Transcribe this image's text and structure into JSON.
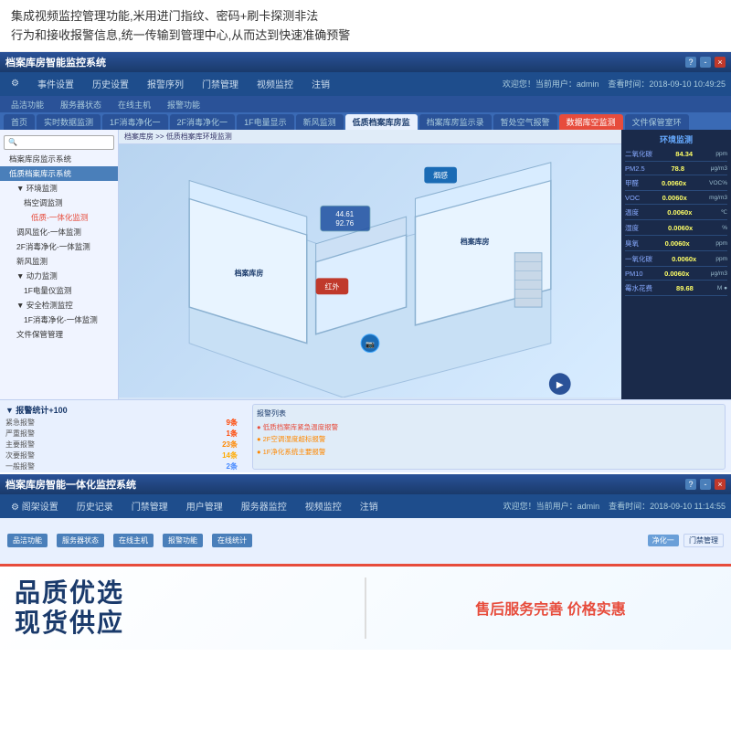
{
  "top_text": {
    "line1": "集成视频监控管理功能,米用进门指纹、密码+刷卡探测非法",
    "line2": "行为和接收报警信息,统一传输到管理中心,从而达到快速准确预警"
  },
  "monitoring_system_1": {
    "title": "档案库房智能监控系统",
    "controls": [
      "?",
      "-",
      "□",
      "×"
    ],
    "navbar": {
      "items": [
        "阁架设置",
        "事件设置",
        "历史设置",
        "报警序列",
        "门禁管理",
        "视频监控",
        "注销"
      ],
      "info": "欢迎您！当前用户：admin",
      "time": "查看时间：2018-09-10 10:49:25"
    },
    "tabs": [
      {
        "label": "品洁功能",
        "active": false
      },
      {
        "label": "服务器状态",
        "active": false
      },
      {
        "label": "在线主机",
        "active": false
      },
      {
        "label": "报警功能",
        "active": false
      }
    ],
    "content_tabs": [
      {
        "label": "首页",
        "active": false
      },
      {
        "label": "实时数据监测",
        "active": false
      },
      {
        "label": "1F消毒净化一",
        "active": false
      },
      {
        "label": "2F消毒净化一",
        "active": false
      },
      {
        "label": "1F电量显示",
        "active": false
      },
      {
        "label": "新风监测",
        "active": false
      },
      {
        "label": "低质档案库房监",
        "active": true,
        "highlight": false
      },
      {
        "label": "档案库房监示录",
        "active": false
      },
      {
        "label": "暂处空气报警",
        "active": false
      },
      {
        "label": "数据库空监测",
        "active": false,
        "highlight": true
      },
      {
        "label": "文件保管室环",
        "active": false
      }
    ],
    "breadcrumb": "档案库房 >> 低质档案库环境监测",
    "sidebar": {
      "tree": [
        {
          "label": "档案库房监示系统",
          "level": 0
        },
        {
          "label": "低质档案库示系统",
          "level": 1,
          "selected": true
        },
        {
          "label": "环境监测",
          "level": 2
        },
        {
          "label": "档空调监测",
          "level": 3
        },
        {
          "label": "低质-一体化监测",
          "level": 3,
          "red": true
        },
        {
          "label": "调风监化-一体监测",
          "level": 2
        },
        {
          "label": "2F消毒净化-一体监测",
          "level": 2
        },
        {
          "label": "新风监测",
          "level": 2
        },
        {
          "label": "动力监测",
          "level": 2
        },
        {
          "label": "1F电量仪监测",
          "level": 3
        },
        {
          "label": "安全检测监控",
          "level": 2
        },
        {
          "label": "1F消毒净化-一体监测",
          "level": 3
        },
        {
          "label": "文件保管管理",
          "level": 2
        }
      ]
    },
    "floor_sensors": [
      {
        "label": "烟感",
        "x": "62%",
        "y": "12%"
      },
      {
        "label": "红外",
        "x": "33%",
        "y": "52%"
      },
      {
        "label": "44.61\n92.76",
        "x": "40%",
        "y": "26%",
        "type": "value"
      }
    ],
    "environment": {
      "title": "环境监测",
      "rows": [
        {
          "label": "二氧化碳",
          "value": "84.34",
          "unit": "ppm"
        },
        {
          "label": "PM2.5",
          "value": "78.8",
          "unit": "μg/m3"
        },
        {
          "label": "甲醛",
          "value": "0.0060x",
          "unit": "VOC%"
        },
        {
          "label": "VOC",
          "value": "0.0060x",
          "unit": "mg/m3"
        },
        {
          "label": "温度",
          "value": "0.0060x",
          "unit": "℃"
        },
        {
          "label": "湿度",
          "value": "0.0060x",
          "unit": "%"
        },
        {
          "label": "臭氧",
          "value": "0.0060x",
          "unit": "ppm"
        },
        {
          "label": "一氧化碳",
          "value": "0.0060x",
          "unit": "ppm"
        },
        {
          "label": "PM10",
          "value": "0.0060x",
          "unit": "μg/m3"
        },
        {
          "label": "霉水花费",
          "value": "89.68",
          "unit": "M ●"
        }
      ]
    },
    "alerts": {
      "title": "报警统计+100",
      "items": [
        {
          "label": "紧急报警",
          "count": "9条"
        },
        {
          "label": "严重报警",
          "count": "1条"
        },
        {
          "label": "主要报警",
          "count": "23条"
        },
        {
          "label": "次要报警",
          "count": "14条"
        },
        {
          "label": "一般报警",
          "count": "2条"
        }
      ]
    }
  },
  "monitoring_system_2": {
    "title": "档案库房智能一体化监控系统",
    "navbar": {
      "items": [
        "阁架设置",
        "历史记录",
        "门禁管理",
        "用户管理",
        "服务器监控",
        "视频监控",
        "注销"
      ],
      "info": "欢迎您！当前用户：admin",
      "time": "查看时间：2018-09-10 11:14:55"
    },
    "tabs": [
      {
        "label": "品洁功能"
      },
      {
        "label": "服务器状态"
      },
      {
        "label": "在线主机"
      },
      {
        "label": "报警功能"
      },
      {
        "label": "在线统计"
      }
    ],
    "content_tabs": [
      {
        "label": "净化一"
      },
      {
        "label": "门禁管理",
        "active": true
      }
    ]
  },
  "bottom_ad": {
    "main_text_line1": "品质优选",
    "main_text_line2": "现货供应",
    "sub_text": "售后服务完善 价格实惠"
  }
}
